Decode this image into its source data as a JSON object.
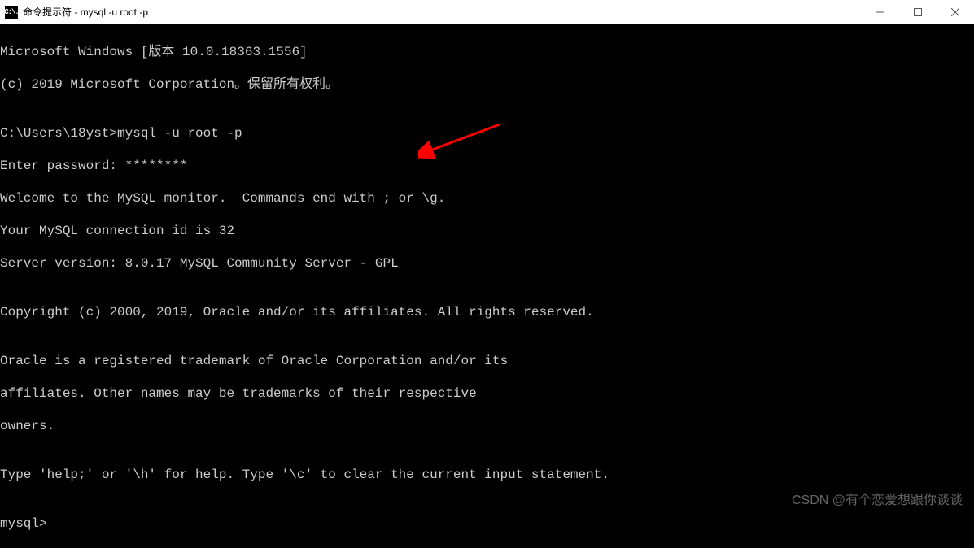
{
  "window": {
    "icon_label": "C:\\.",
    "title": "命令提示符 - mysql  -u root -p"
  },
  "terminal": {
    "lines": [
      "Microsoft Windows [版本 10.0.18363.1556]",
      "(c) 2019 Microsoft Corporation。保留所有权利。",
      "",
      "C:\\Users\\18yst>mysql -u root -p",
      "Enter password: ********",
      "Welcome to the MySQL monitor.  Commands end with ; or \\g.",
      "Your MySQL connection id is 32",
      "Server version: 8.0.17 MySQL Community Server - GPL",
      "",
      "Copyright (c) 2000, 2019, Oracle and/or its affiliates. All rights reserved.",
      "",
      "Oracle is a registered trademark of Oracle Corporation and/or its",
      "affiliates. Other names may be trademarks of their respective",
      "owners.",
      "",
      "Type 'help;' or '\\h' for help. Type '\\c' to clear the current input statement.",
      "",
      "mysql>"
    ]
  },
  "watermark": "CSDN @有个恋爱想跟你谈谈"
}
